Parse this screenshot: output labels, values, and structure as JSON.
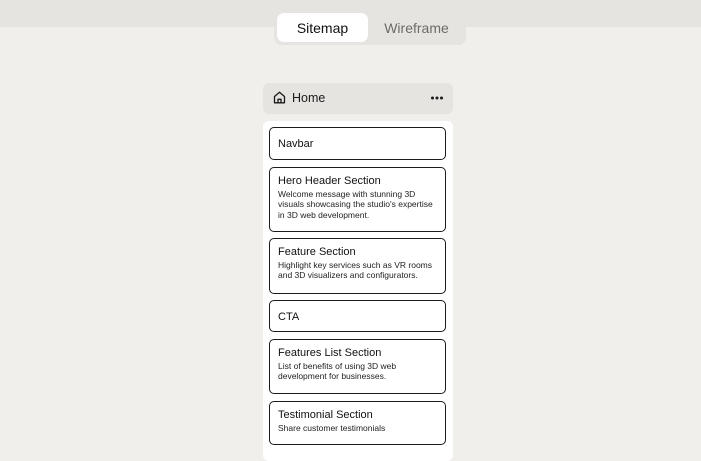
{
  "view_toggle": {
    "tabs": [
      {
        "label": "Sitemap",
        "active": true
      },
      {
        "label": "Wireframe",
        "active": false
      }
    ]
  },
  "page": {
    "title": "Home",
    "icon": "home-icon",
    "menu_icon": "more-horizontal-icon"
  },
  "sections": [
    {
      "title": "Navbar",
      "description": ""
    },
    {
      "title": "Hero Header Section",
      "description": "Welcome message with stunning 3D visuals showcasing the studio's expertise in 3D web development."
    },
    {
      "title": "Feature Section",
      "description": "Highlight key services such as VR rooms and 3D visualizers and configurators."
    },
    {
      "title": "CTA",
      "description": ""
    },
    {
      "title": "Features List Section",
      "description": "List of benefits of using 3D web development for businesses."
    },
    {
      "title": "Testimonial Section",
      "description": "Share customer testimonials"
    }
  ],
  "colors": {
    "background": "#f0efec",
    "toolbar": "#e5e4e0",
    "card_border": "#1b1b1b",
    "inactive_tab_text": "#6b6b68"
  }
}
